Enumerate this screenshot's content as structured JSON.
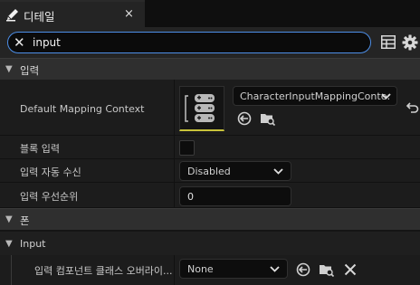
{
  "tab": {
    "title": "디테일",
    "close": "×"
  },
  "search": {
    "value": "input",
    "clear": "✕"
  },
  "sections": {
    "input": {
      "label": "입력"
    },
    "pawn": {
      "label": "폰"
    },
    "input_sub": {
      "label": "Input"
    }
  },
  "rows": {
    "mapping_context": {
      "name": "Default Mapping Context",
      "value": "CharacterInputMappingConte:"
    },
    "block_input": {
      "name": "블록 입력",
      "checked": false
    },
    "auto_receive": {
      "name": "입력 자동 수신",
      "value": "Disabled"
    },
    "input_priority": {
      "name": "입력 우선순위",
      "value": "0"
    },
    "component_override": {
      "name": "입력 컴포넌트 클래스 오버라이...",
      "value": "None"
    }
  },
  "colors": {
    "accent_blue": "#4d8fe8",
    "thumbnail_underline": "#c8c33a",
    "background": "#151515"
  }
}
